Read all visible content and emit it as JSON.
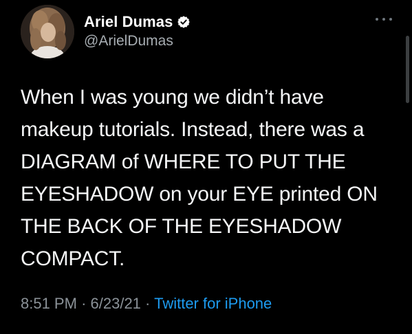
{
  "author": {
    "display_name": "Ariel Dumas",
    "handle": "@ArielDumas",
    "verified": true
  },
  "tweet": {
    "lines": [
      "When I was young we didn’t have",
      "makeup tutorials. Instead, there was a",
      "DIAGRAM of WHERE TO PUT THE",
      "EYESHADOW on your EYE printed ON",
      "THE BACK OF THE EYESHADOW",
      "COMPACT."
    ],
    "time": "8:51 PM",
    "date": "6/23/21",
    "separator": "·",
    "source": "Twitter for iPhone"
  },
  "icons": {
    "verified": "verified-badge-icon",
    "more": "more-options-icon"
  },
  "colors": {
    "background": "#000000",
    "text": "#f5f6f7",
    "secondary": "#8b9298",
    "link": "#1d9bf0"
  }
}
